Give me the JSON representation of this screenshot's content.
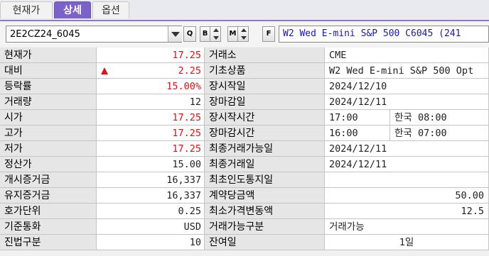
{
  "tabs": [
    {
      "label": "현재가",
      "active": false
    },
    {
      "label": "상세",
      "active": true
    },
    {
      "label": "옵션",
      "active": false
    }
  ],
  "toolbar": {
    "symbol_code": "2E2CZ24_6045",
    "btn_search": "Q",
    "btn_b": "B",
    "btn_m": "M",
    "btn_f": "F",
    "instrument_name": "W2 Wed E-mini S&P 500 C6045 (241"
  },
  "left": {
    "rows": [
      {
        "label": "현재가",
        "value": "17.25",
        "color": "red"
      },
      {
        "label": "대비",
        "value": "2.25",
        "color": "red",
        "arrow": "up"
      },
      {
        "label": "등락률",
        "value": "15.00%",
        "color": "red"
      },
      {
        "label": "거래량",
        "value": "12",
        "color": "black"
      },
      {
        "label": "시가",
        "value": "17.25",
        "color": "red"
      },
      {
        "label": "고가",
        "value": "17.25",
        "color": "red"
      },
      {
        "label": "저가",
        "value": "17.25",
        "color": "red"
      },
      {
        "label": "정산가",
        "value": "15.00",
        "color": "black"
      },
      {
        "label": "개시증거금",
        "value": "16,337",
        "color": "black"
      },
      {
        "label": "유지증거금",
        "value": "16,337",
        "color": "black"
      },
      {
        "label": "호가단위",
        "value": "0.25",
        "color": "black"
      },
      {
        "label": "기준통화",
        "value": "USD",
        "color": "black"
      },
      {
        "label": "진법구분",
        "value": "10",
        "color": "black"
      }
    ]
  },
  "right": {
    "rows": [
      {
        "label": "거래소",
        "value": "CME"
      },
      {
        "label": "기초상품",
        "value": "W2 Wed E-mini S&P 500 Opt"
      },
      {
        "label": "장시작일",
        "value": "2024/12/10"
      },
      {
        "label": "장마감일",
        "value": "2024/12/11"
      },
      {
        "label": "장시작시간",
        "value": "17:00",
        "value2": "한국 08:00"
      },
      {
        "label": "장마감시간",
        "value": "16:00",
        "value2": "한국 07:00"
      },
      {
        "label": "최종거래가능일",
        "value": "2024/12/11"
      },
      {
        "label": "최종거래일",
        "value": "2024/12/11"
      },
      {
        "label": "최초인도통지일",
        "value": ""
      },
      {
        "label": "계약당금액",
        "value": "50.00",
        "align": "right"
      },
      {
        "label": "최소가격변동액",
        "value": "12.5",
        "align": "right"
      },
      {
        "label": "거래가능구분",
        "value": "거래가능"
      },
      {
        "label": "잔여일",
        "value": "1일",
        "align": "center"
      }
    ]
  },
  "colors": {
    "red": "#d4151b",
    "black": "#222222",
    "accent": "#7b62c8",
    "name_text": "#1a1aa0"
  },
  "icons": {
    "dropdown": "chevron-down-icon",
    "search": "search-icon",
    "b_stepper": "b-stepper-icon",
    "m_stepper": "m-stepper-icon",
    "f_button": "f-icon"
  }
}
